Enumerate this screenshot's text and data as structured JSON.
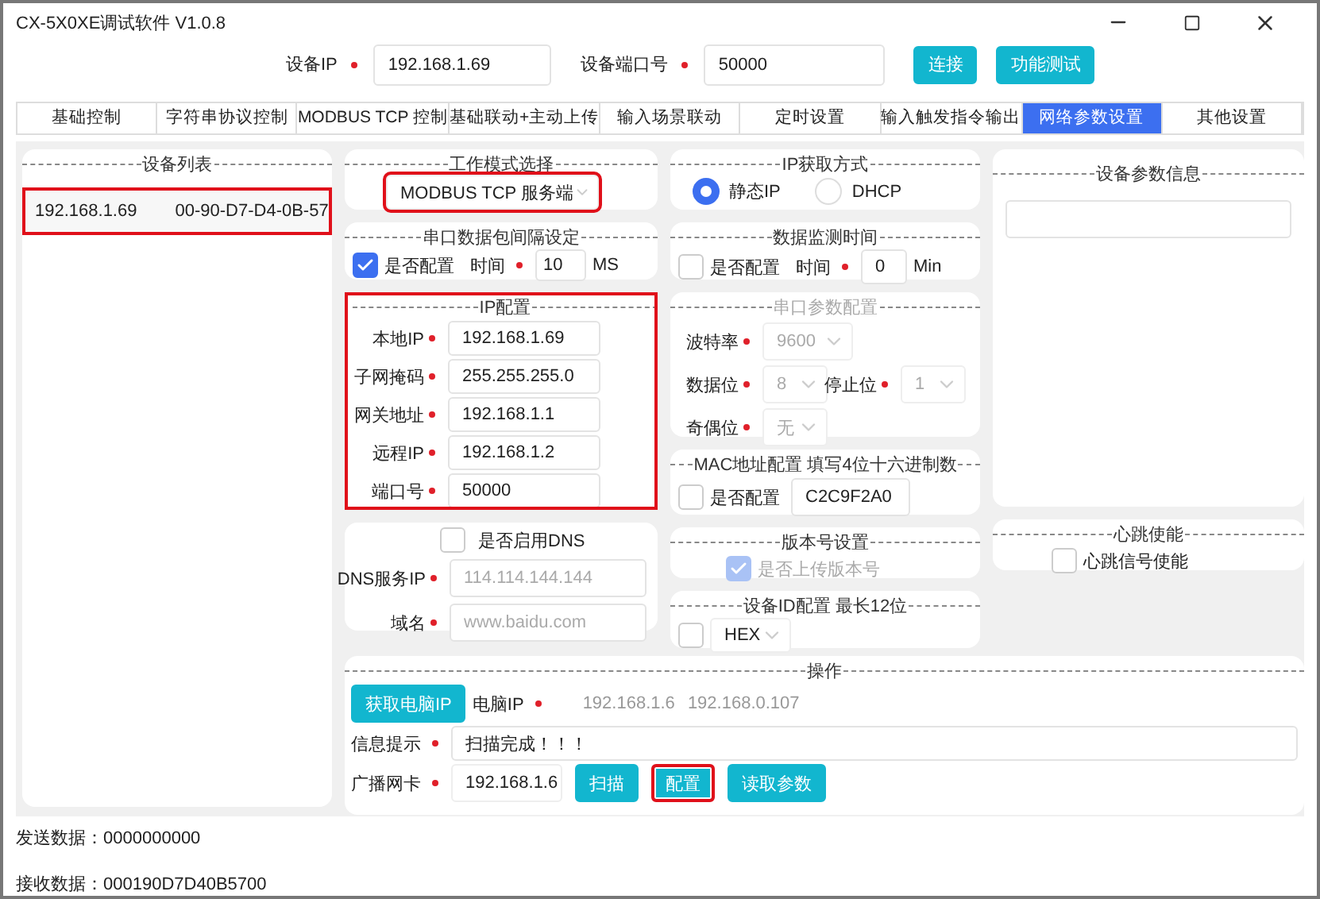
{
  "window": {
    "title": "CX-5X0XE调试软件 V1.0.8"
  },
  "connection": {
    "ip_label": "设备IP",
    "ip": "192.168.1.69",
    "port_label": "设备端口号",
    "port": "50000",
    "buttons": [
      "连接",
      "功能测试"
    ]
  },
  "tabs": [
    {
      "label": "基础控制",
      "selected": false
    },
    {
      "label": "字符串协议控制",
      "selected": false
    },
    {
      "label": "MODBUS TCP 控制",
      "selected": false
    },
    {
      "label": "基础联动+主动上传",
      "selected": false
    },
    {
      "label": "输入场景联动",
      "selected": false
    },
    {
      "label": "定时设置",
      "selected": false
    },
    {
      "label": "输入触发指令输出",
      "selected": false
    },
    {
      "label": "网络参数设置",
      "selected": true
    },
    {
      "label": "其他设置",
      "selected": false
    }
  ],
  "device_list": {
    "title": "设备列表",
    "rows": [
      {
        "ip": "192.168.1.69",
        "mac": "00-90-D7-D4-0B-57",
        "highlighted": true
      }
    ]
  },
  "work_mode": {
    "title": "工作模式选择",
    "value": "MODBUS TCP 服务端",
    "highlighted": true
  },
  "serial_interval": {
    "title": "串口数据包间隔设定",
    "checkbox": {
      "label": "是否配置",
      "checked": true
    },
    "time_label": "时间",
    "value": "10",
    "unit": "MS"
  },
  "ip_config": {
    "title": "IP配置",
    "highlighted": true,
    "fields": [
      {
        "label": "本地IP",
        "value": "192.168.1.69"
      },
      {
        "label": "子网掩码",
        "value": "255.255.255.0"
      },
      {
        "label": "网关地址",
        "value": "192.168.1.1"
      },
      {
        "label": "远程IP",
        "value": "192.168.1.2"
      },
      {
        "label": "端口号",
        "value": "50000"
      }
    ]
  },
  "dns": {
    "checkbox": {
      "label": "是否启用DNS",
      "checked": false
    },
    "fields": [
      {
        "label": "DNS服务IP",
        "placeholder": "114.114.144.144"
      },
      {
        "label": "域名",
        "placeholder": "www.baidu.com"
      }
    ]
  },
  "ip_method": {
    "title": "IP获取方式",
    "options": [
      {
        "label": "静态IP",
        "selected": true
      },
      {
        "label": "DHCP",
        "selected": false
      }
    ]
  },
  "data_monitor": {
    "title": "数据监测时间",
    "checkbox": {
      "label": "是否配置",
      "checked": false
    },
    "time_label": "时间",
    "value": "0",
    "unit": "Min"
  },
  "serial_params": {
    "title": "串口参数配置",
    "disabled": true,
    "rows": [
      [
        {
          "label": "波特率",
          "value": "9600"
        }
      ],
      [
        {
          "label": "数据位",
          "value": "8"
        },
        {
          "label": "停止位",
          "value": "1"
        }
      ],
      [
        {
          "label": "奇偶位",
          "value": "无"
        }
      ]
    ]
  },
  "mac": {
    "title": "MAC地址配置 填写4位十六进制数",
    "checkbox": {
      "label": "是否配置",
      "checked": false
    },
    "value": "C2C9F2A0"
  },
  "version": {
    "title": "版本号设置",
    "checkbox": {
      "label": "是否上传版本号",
      "checked": true,
      "disabled": true
    }
  },
  "device_id": {
    "title": "设备ID配置  最长12位",
    "checkbox": {
      "checked": false
    },
    "format": "HEX"
  },
  "device_info": {
    "title": "设备参数信息"
  },
  "heartbeat": {
    "title": "心跳使能",
    "checkbox": {
      "label": "心跳信号使能",
      "checked": false
    }
  },
  "operations": {
    "title": "操作",
    "get_ip_button": "获取电脑IP",
    "pc_ip_label": "电脑IP",
    "pc_ips": [
      "192.168.1.6",
      "192.168.0.107"
    ],
    "message_label": "信息提示",
    "message": "扫描完成！！！",
    "nic_label": "广播网卡",
    "nic": "192.168.1.6",
    "buttons": [
      {
        "label": "扫描",
        "highlighted": false
      },
      {
        "label": "配置",
        "highlighted": true
      },
      {
        "label": "读取参数",
        "highlighted": false
      }
    ]
  },
  "status": [
    "发送数据：0000000000",
    "接收数据：000190D7D40B5700"
  ]
}
